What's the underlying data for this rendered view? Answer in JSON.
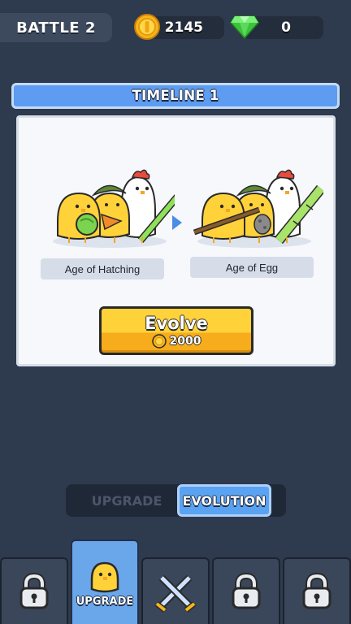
{
  "header": {
    "battle_label": "BATTLE 2",
    "coins": "2145",
    "gems": "0"
  },
  "timeline": {
    "title": "TIMELINE 1",
    "current_age": "Age of Hatching",
    "next_age": "Age of Egg",
    "evolve": {
      "label": "Evolve",
      "cost": "2000"
    }
  },
  "mode_toggle": {
    "options": [
      "UPGRADE",
      "EVOLUTION"
    ],
    "selected": "EVOLUTION"
  },
  "bottom_nav": {
    "tabs": [
      {
        "icon": "lock-icon",
        "label": "",
        "state": "locked"
      },
      {
        "icon": "chick-icon",
        "label": "UPGRADE",
        "state": "active"
      },
      {
        "icon": "crossed-swords-icon",
        "label": "",
        "state": "normal"
      },
      {
        "icon": "lock-icon",
        "label": "",
        "state": "locked"
      },
      {
        "icon": "lock-icon",
        "label": "",
        "state": "locked"
      }
    ]
  },
  "colors": {
    "background": "#2e3a4d",
    "accent_blue": "#5d9cf0",
    "evolve_yellow": "#ffd23a",
    "coin_gold": "#f7b519",
    "gem_green": "#4bd84b"
  }
}
